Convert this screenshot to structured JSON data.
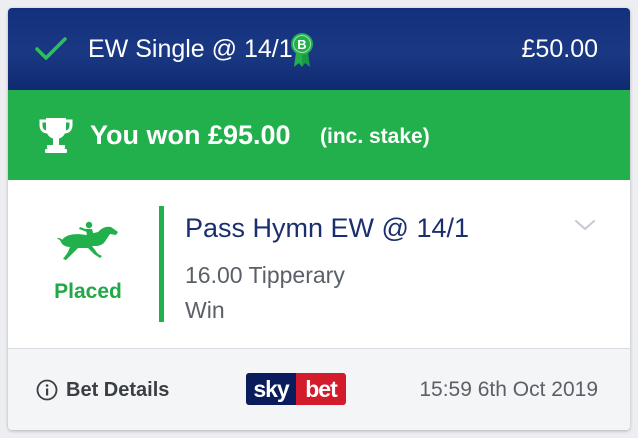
{
  "header": {
    "bet_type": "EW Single @ 14/1",
    "stake": "£50.00",
    "boost_badge": "B",
    "icons": {
      "status": "check-icon",
      "boost": "boost-badge-icon"
    }
  },
  "result": {
    "won_text": "You won £95.00",
    "stake_note": "(inc. stake)",
    "icon": "trophy-icon"
  },
  "selection": {
    "status": "Placed",
    "name": "Pass Hymn EW @ 14/1",
    "race": "16.00 Tipperary",
    "market": "Win",
    "icon": "horse-racing-icon"
  },
  "footer": {
    "bet_details_label": "Bet Details",
    "brand_sky": "sky",
    "brand_bet": "bet",
    "timestamp": "15:59 6th Oct 2019"
  },
  "colors": {
    "header_bg": "#12307b",
    "win_bg": "#21b04b",
    "selection_name": "#1b2f6e",
    "placed_green": "#21a847",
    "brand_navy": "#0a1c5c",
    "brand_red": "#d21c2b"
  }
}
